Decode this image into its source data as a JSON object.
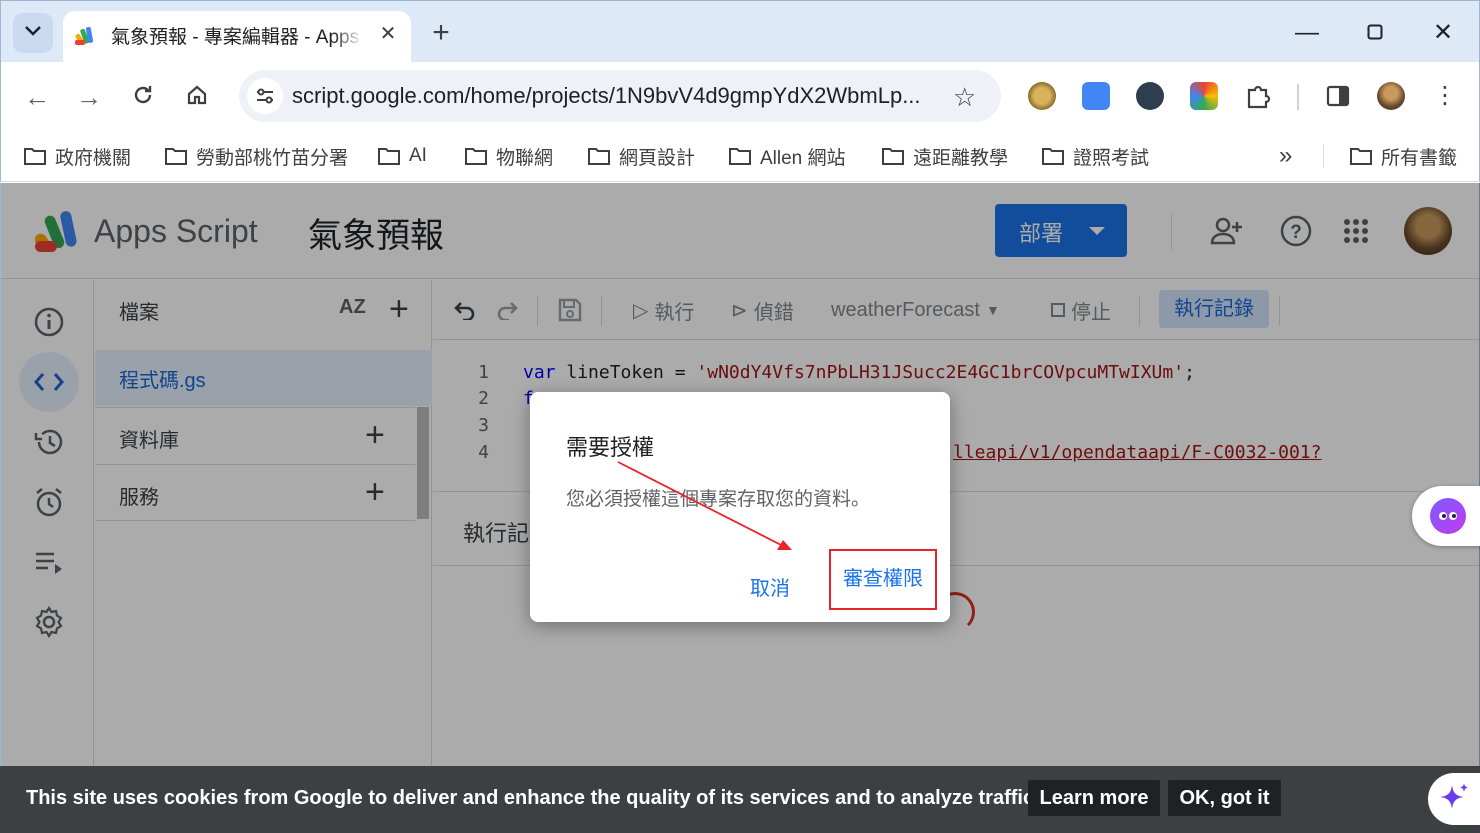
{
  "browser": {
    "tab_title": "氣象預報 - 專案編輯器 - Apps Script",
    "new_tab_label": "+",
    "url": "script.google.com/home/projects/1N9bvV4d9gmpYdX2WbmLp...",
    "bookmarks": [
      "政府機關",
      "勞動部桃竹苗分署",
      "AI",
      "物聯網",
      "網頁設計",
      "Allen 網站",
      "遠距離教學",
      "證照考試"
    ],
    "bookmarks_overflow": "»",
    "all_bookmarks": "所有書籤"
  },
  "app": {
    "name": "Apps Script",
    "project_title": "氣象預報",
    "deploy_label": "部署"
  },
  "files_panel": {
    "title": "檔案",
    "sort_label": "AZ",
    "file_name": "程式碼.gs",
    "libraries_label": "資料庫",
    "services_label": "服務"
  },
  "editor_toolbar": {
    "run_label": "執行",
    "debug_label": "偵錯",
    "function_name": "weatherForecast",
    "stop_label": "停止",
    "log_label": "執行記錄"
  },
  "code": {
    "line_numbers": [
      "1",
      "2",
      "3",
      "4"
    ],
    "line1_kw": "var",
    "line1_name": " lineToken = ",
    "line1_str": "'wN0dY4Vfs7nPbLH31JSucc2E4GC1brCOVpcuMTwIXUm'",
    "line1_end": ";",
    "line2_kw": "f",
    "line4_str": "lleapi/v1/opendataapi/F-C0032-001?"
  },
  "log_panel": {
    "title": "執行記錄"
  },
  "dialog": {
    "title": "需要授權",
    "body": "您必須授權這個專案存取您的資料。",
    "cancel_label": "取消",
    "review_label": "審查權限"
  },
  "cookie_bar": {
    "message": "This site uses cookies from Google to deliver and enhance the quality of its services and to analyze traffic.",
    "learn_more": "Learn more",
    "ok": "OK, got it"
  },
  "colors": {
    "primary": "#1a73e8",
    "annotation_red": "#e8232a"
  }
}
